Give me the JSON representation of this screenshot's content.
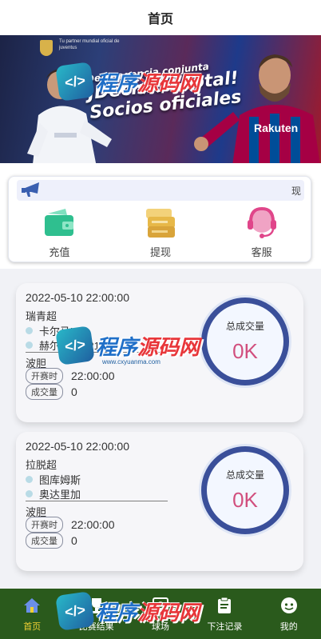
{
  "header": {
    "title": "首页"
  },
  "banner": {
    "headline_lines": [
      "De la agencia conjunta",
      "JDecisión total!",
      "Socios oficiales"
    ],
    "subtext": "Tu partner mundial oficial de juventus",
    "sponsor": "Rakuten",
    "slide_index": 1,
    "slide_count": 3
  },
  "watermark": {
    "brand_blue": "程序",
    "brand_red": "源码网",
    "url": "www.cxyuanma.com",
    "logo_glyph": "</>"
  },
  "notice": {
    "icon": "megaphone-icon",
    "text": "现"
  },
  "quick_actions": [
    {
      "label": "充值",
      "icon": "wallet-icon",
      "color": "#2fbf8f"
    },
    {
      "label": "提现",
      "icon": "cards-icon",
      "color": "#e7b848"
    },
    {
      "label": "客服",
      "icon": "headset-icon",
      "color": "#e0468a"
    }
  ],
  "matches": [
    {
      "datetime": "2022-05-10 22:00:00",
      "league": "瑞青超",
      "home": "卡尔马U21",
      "away": "赫尔辛堡U21",
      "bet_label": "波胆",
      "start_tag": "开赛时",
      "start_time": "22:00:00",
      "volume_tag": "成交量",
      "volume": "0",
      "total_label": "总成交量",
      "total_value": "0K"
    },
    {
      "datetime": "2022-05-10 22:00:00",
      "league": "拉脱超",
      "home": "图库姆斯",
      "away": "奥达里加",
      "bet_label": "波胆",
      "start_tag": "开赛时",
      "start_time": "22:00:00",
      "volume_tag": "成交量",
      "volume": "0",
      "total_label": "总成交量",
      "total_value": "0K"
    }
  ],
  "tabbar": {
    "items": [
      {
        "label": "首页",
        "icon": "home-icon",
        "active": true
      },
      {
        "label": "比赛结果",
        "icon": "trophy-icon",
        "active": false
      },
      {
        "label": "球场",
        "icon": "field-icon",
        "active": false
      },
      {
        "label": "下注记录",
        "icon": "clipboard-icon",
        "active": false
      },
      {
        "label": "我的",
        "icon": "user-face-icon",
        "active": false
      }
    ],
    "background": "#2a5a1c",
    "active_color": "#f0d034"
  }
}
